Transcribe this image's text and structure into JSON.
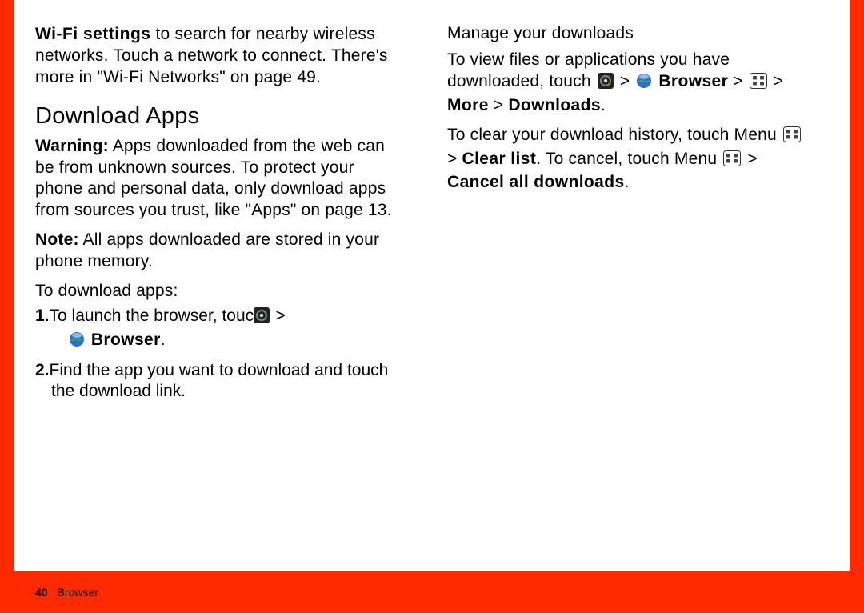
{
  "left": {
    "wifi_para_pre": "Wi-Fi settings",
    "wifi_para_rest": " to search for nearby wireless networks. Touch a network to connect. There's more in \"Wi-Fi Networks\" on page 49.",
    "heading": "Download Apps",
    "warn_label": "Warning:",
    "warn_body": " Apps downloaded from the web can be from unknown sources. To protect your phone and personal data, only download apps from sources you trust, like \"Apps\" on page 13.",
    "note_label": "Note:",
    "note_body": " All apps downloaded are stored in your phone memory.",
    "todl": "To download apps:",
    "step1_num": "1.",
    "step1_a": "To launch the browser, touch ",
    "step1_b": " > ",
    "step1_c": "Browser",
    "step1_d": ".",
    "step2_num": "2.",
    "step2": "Find the app you want to download and touch the download link."
  },
  "right": {
    "heading": "Manage your downloads",
    "p1a": "To view files or applications you have downloaded, touch ",
    "p1b": " > ",
    "p1c": "Browser",
    "p1d": " > ",
    "p1e": " > ",
    "p1f": "More",
    "p1g": " > ",
    "p1h": "Downloads",
    "p1i": ".",
    "p2a": "To clear your download history, touch Menu ",
    "p2b": " > ",
    "p2c": "Clear list",
    "p2d": ". To cancel, touch Menu ",
    "p2e": " > ",
    "p2f": "Cancel all downloads",
    "p2g": "."
  },
  "footer": {
    "page": "40",
    "section": "Browser"
  }
}
